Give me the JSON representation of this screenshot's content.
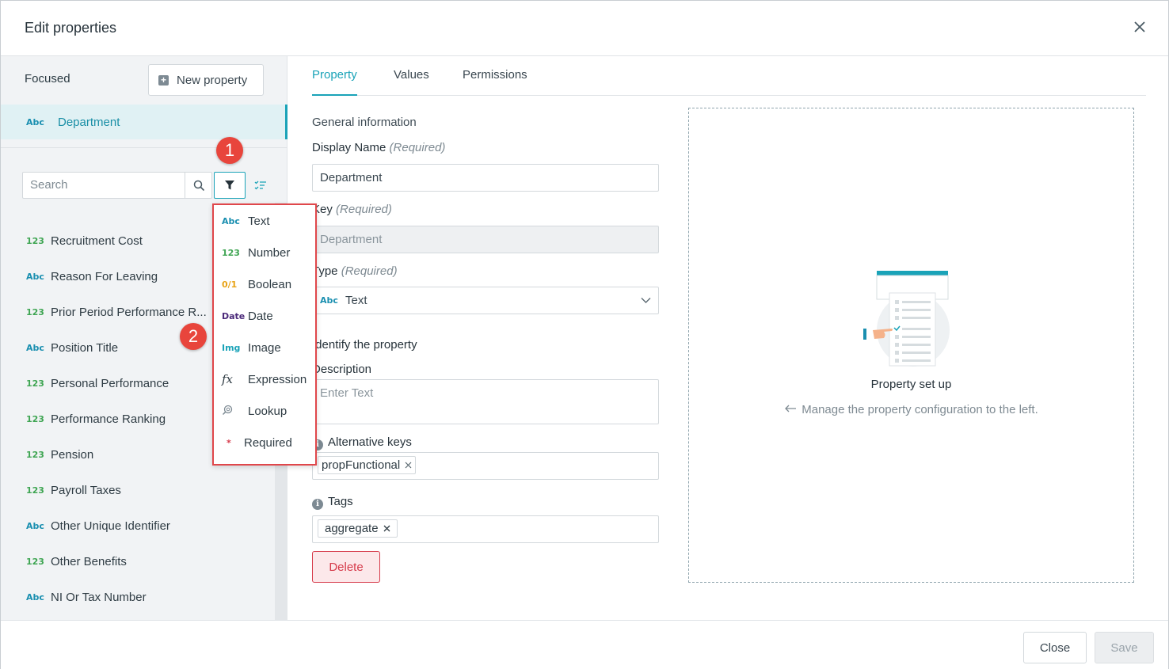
{
  "dialog": {
    "title": "Edit properties",
    "close_icon": "close-icon"
  },
  "left": {
    "focused_label": "Focused",
    "new_property_label": "New property",
    "focused_item": {
      "type": "Abc",
      "name": "Department"
    },
    "search": {
      "placeholder": "Search"
    },
    "items": [
      {
        "type": "123",
        "name": "Recruitment Cost"
      },
      {
        "type": "Abc",
        "name": "Reason For Leaving"
      },
      {
        "type": "123",
        "name": "Prior Period Performance R..."
      },
      {
        "type": "Abc",
        "name": "Position Title"
      },
      {
        "type": "123",
        "name": "Personal Performance"
      },
      {
        "type": "123",
        "name": "Performance Ranking"
      },
      {
        "type": "123",
        "name": "Pension"
      },
      {
        "type": "123",
        "name": "Payroll Taxes"
      },
      {
        "type": "Abc",
        "name": "Other Unique Identifier"
      },
      {
        "type": "123",
        "name": "Other Benefits"
      },
      {
        "type": "Abc",
        "name": "NI Or Tax Number"
      }
    ]
  },
  "badges": {
    "one": "1",
    "two": "2"
  },
  "filter_menu": [
    {
      "icon": "Abc",
      "label": "Text",
      "color": "#1a8fb0"
    },
    {
      "icon": "123",
      "label": "Number",
      "color": "#3fa553"
    },
    {
      "icon": "0/1",
      "label": "Boolean",
      "color": "#e8a317"
    },
    {
      "icon": "Date",
      "label": "Date",
      "color": "#4b2a7a"
    },
    {
      "icon": "Img",
      "label": "Image",
      "color": "#1aa3b8"
    },
    {
      "icon": "fx",
      "label": "Expression",
      "color": "#2f3c44"
    },
    {
      "icon": "lookup-icon",
      "label": "Lookup",
      "color": "#7d8a93"
    },
    {
      "icon": "*",
      "label": "Required",
      "color": "#d63a4a"
    }
  ],
  "tabs": [
    {
      "label": "Property",
      "active": true
    },
    {
      "label": "Values",
      "active": false
    },
    {
      "label": "Permissions",
      "active": false
    }
  ],
  "form": {
    "general_heading": "General information",
    "display_name_label": "Display Name",
    "required_text": "(Required)",
    "display_name_value": "Department",
    "key_label": "Key",
    "key_value": "Department",
    "type_label": "Type",
    "type_icon": "Abc",
    "type_value": "Text",
    "identify_heading": "Identify the property",
    "description_label": "Description",
    "description_placeholder": "Enter Text",
    "alt_keys_label": "Alternative keys",
    "alt_keys_chips": [
      "propFunctional"
    ],
    "tags_label": "Tags",
    "tags_chips": [
      "aggregate"
    ],
    "delete_label": "Delete"
  },
  "panel": {
    "title": "Property set up",
    "hint": "Manage the property configuration to the left."
  },
  "footer": {
    "close_label": "Close",
    "save_label": "Save"
  },
  "colors": {
    "accent": "#1aa3b8",
    "danger": "#d63a4a",
    "badge": "#e8453c"
  }
}
